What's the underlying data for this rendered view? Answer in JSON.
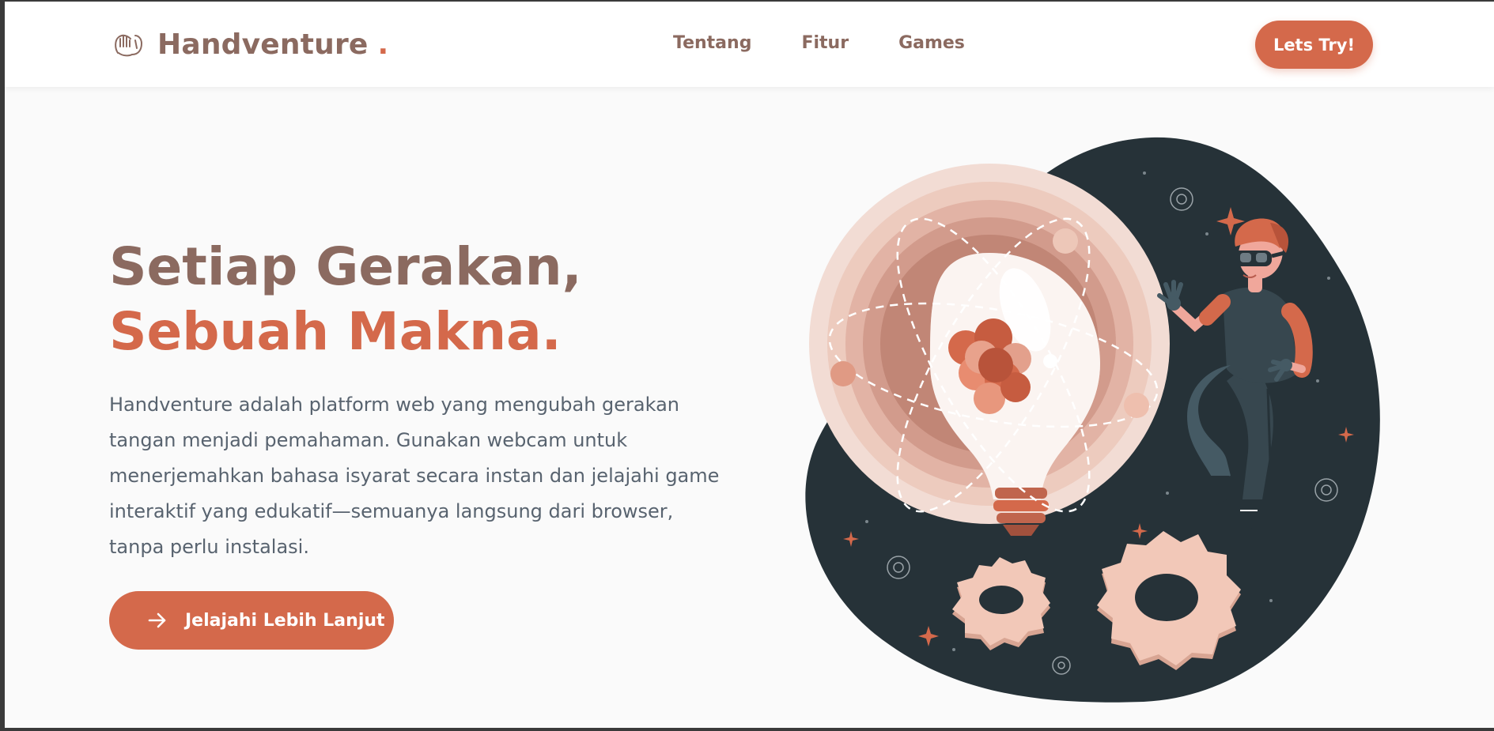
{
  "brand": {
    "name": "Handventure",
    "dot": ".",
    "logo_icon": "hand-wave-icon"
  },
  "nav": {
    "links": [
      {
        "label": "Tentang"
      },
      {
        "label": "Fitur"
      },
      {
        "label": "Games"
      }
    ],
    "cta_label": "Lets Try!"
  },
  "hero": {
    "title_line1": "Setiap Gerakan,",
    "title_line2": "Sebuah Makna.",
    "description": "Handventure adalah platform web yang mengubah gerakan tangan menjadi pemahaman. Gunakan webcam untuk menerjemahkan bahasa isyarat secara instan dan jelajahi game interaktif yang edukatif—semuanya langsung dari browser, tanpa perlu instalasi.",
    "button_label": "Jelajahi Lebih Lanjut",
    "button_icon": "arrow-right-icon",
    "illustration": "lightbulb-vr-person-gears-illustration"
  },
  "colors": {
    "accent": "#d4694b",
    "brown": "#8b6a60",
    "dark": "#263238",
    "peach": "#e8b8a8",
    "text": "#58636f"
  }
}
